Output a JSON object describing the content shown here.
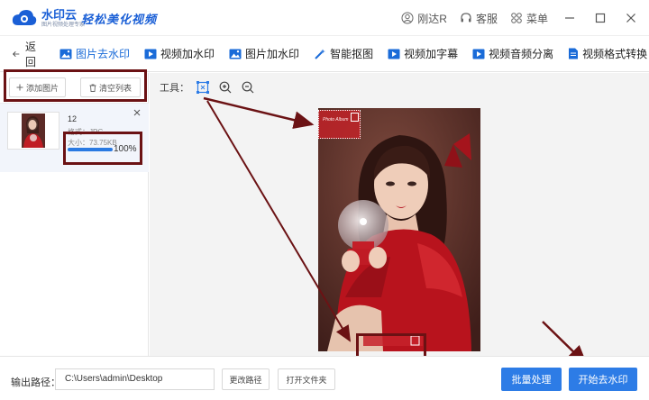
{
  "app": {
    "brand_name": "水印云",
    "brand_sub": "图片视频处理专家",
    "slogan": "轻松美化视频"
  },
  "titlebar": {
    "user": "刚达R",
    "service": "客服",
    "menu": "菜单"
  },
  "nav": {
    "back": "返回",
    "tools": [
      {
        "label": "图片去水印",
        "icon": "image-icon",
        "active": true
      },
      {
        "label": "视频加水印",
        "icon": "video-icon",
        "active": false
      },
      {
        "label": "图片加水印",
        "icon": "image-icon",
        "active": false
      },
      {
        "label": "智能抠图",
        "icon": "magic-wand-icon",
        "active": false
      },
      {
        "label": "视频加字幕",
        "icon": "video-icon",
        "active": false
      },
      {
        "label": "视频音频分离",
        "icon": "video-icon",
        "active": false
      },
      {
        "label": "视频格式转换",
        "icon": "file-icon",
        "active": false
      }
    ]
  },
  "left_panel": {
    "add_image": "添加图片",
    "clear_list": "清空列表",
    "file": {
      "name": "12",
      "format": "格式：JPG",
      "size": "大小：73.75KB",
      "progress_text": "100%",
      "progress": 1.0
    }
  },
  "preview": {
    "tools_label": "工具："
  },
  "watermark": {
    "top_text": "Photo Album"
  },
  "bottom": {
    "output_label": "输出路径：",
    "output_path": "C:\\Users\\admin\\Desktop",
    "change_path": "更改路径",
    "open_folder": "打开文件夹",
    "batch": "批量处理",
    "start": "开始去水印"
  },
  "colors": {
    "accent": "#2d7ce6",
    "annotation": "#6b1214"
  }
}
